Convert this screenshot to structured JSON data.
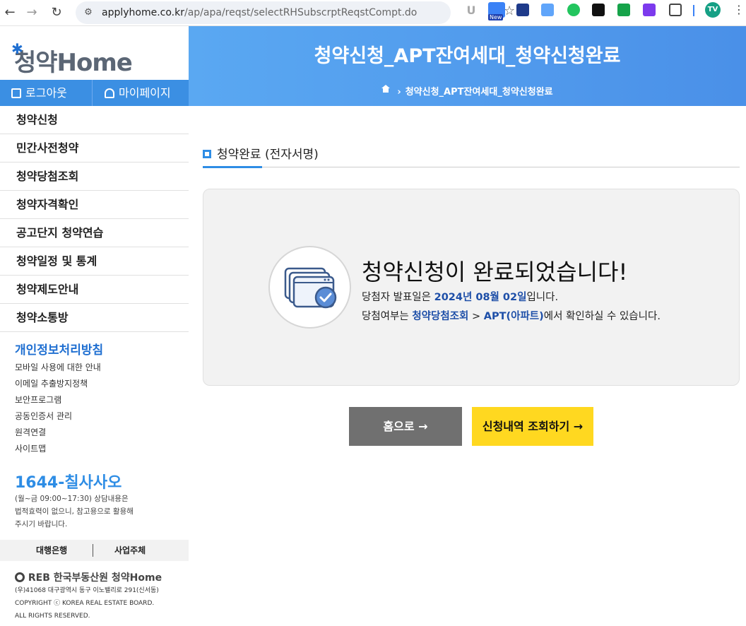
{
  "browser": {
    "url_domain": "applyhome.co.kr",
    "url_path": "/ap/apa/reqst/selectRHSubscrptReqstCompt.do",
    "profile_initials": "TV",
    "ext_badge": "New"
  },
  "sidebar": {
    "logo_text": "청약Home",
    "logout_label": "로그아웃",
    "mypage_label": "마이페이지",
    "menu": [
      {
        "label": "청약신청"
      },
      {
        "label": "민간사전청약"
      },
      {
        "label": "청약당첨조회"
      },
      {
        "label": "청약자격확인"
      },
      {
        "label": "공고단지 청약연습"
      },
      {
        "label": "청약일정 및 통계"
      },
      {
        "label": "청약제도안내"
      },
      {
        "label": "청약소통방"
      }
    ],
    "policy_label": "개인정보처리방침",
    "sublinks": [
      {
        "label": "모바일 사용에 대한 안내"
      },
      {
        "label": "이메일 추출방지정책"
      },
      {
        "label": "보안프로그램"
      },
      {
        "label": "공동인증서 관리"
      },
      {
        "label": "원격연결"
      },
      {
        "label": "사이트맵"
      }
    ],
    "phone": "1644-칠사사오",
    "hours_1": "(월~금 09:00~17:30) 상담내용은",
    "hours_2": "법적효력이 없으니, 참고용으로 활용해",
    "hours_3": "주시기 바랍니다.",
    "bank_label": "대행은행",
    "operator_label": "사업주체",
    "reb_text": "REB 한국부동산원 청약Home",
    "addr_1": "(우)41068 대구광역시 동구 이노밸리로 291(신서동)",
    "addr_2": "COPYRIGHT ⓒ KOREA REAL ESTATE BOARD.",
    "addr_3": "ALL RIGHTS RESERVED."
  },
  "header": {
    "title": "청약신청_APT잔여세대_청약신청완료",
    "breadcrumb": "청약신청_APT잔여세대_청약신청완료"
  },
  "content": {
    "section_title": "청약완료 (전자서명)",
    "main_message": "청약신청이 완료되었습니다!",
    "line1_prefix": "당첨자 발표일은 ",
    "line1_date": "2024년 08월 02일",
    "line1_suffix": "입니다.",
    "line2_prefix": "당첨여부는 ",
    "line2_link1": "청약당첨조회",
    "line2_sep": " > ",
    "line2_link2": "APT(아파트)",
    "line2_suffix": "에서 확인하실 수 있습니다.",
    "home_button": "홈으로 →",
    "view_button": "신청내역 조회하기 →"
  },
  "colors": {
    "accent": "#2e8de5",
    "header_blue": "#4a90e8",
    "highlight": "#1e4fa8",
    "yellow": "#ffd820",
    "gray_button": "#707070"
  }
}
